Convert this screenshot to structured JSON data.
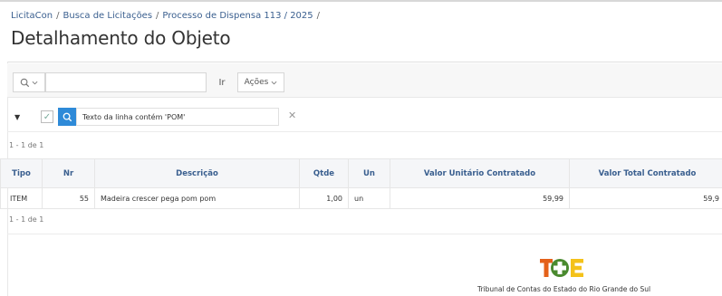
{
  "breadcrumb": {
    "items": [
      "LicitaCon",
      "Busca de Licitações",
      "Processo de Dispensa 113 / 2025"
    ],
    "separator": "/"
  },
  "page": {
    "title": "Detalhamento do Objeto"
  },
  "toolbar": {
    "search_placeholder": "",
    "go_label": "Ir",
    "actions_label": "Ações"
  },
  "filter": {
    "text": "Texto da linha contém 'POM'",
    "enabled": true
  },
  "pagination": {
    "top": "1 - 1 de 1",
    "bottom": "1 - 1 de 1"
  },
  "table": {
    "headers": [
      "Tipo",
      "Nr",
      "Descrição",
      "Qtde",
      "Un",
      "Valor Unitário Contratado",
      "Valor Total Contratado"
    ],
    "rows": [
      {
        "tipo": "ITEM",
        "nr": "55",
        "descricao": "Madeira crescer pega pom pom",
        "qtde": "1,00",
        "un": "un",
        "valor_unitario": "59,99",
        "valor_total": "59,9"
      }
    ]
  },
  "footer": {
    "logo_text": "TCE",
    "caption": "Tribunal de Contas do Estado do Rio Grande do Sul"
  },
  "colors": {
    "accent": "#2e8ad8",
    "link": "#3a5f8f",
    "logo_orange": "#e4611a",
    "logo_yellow": "#f4c21a",
    "logo_green": "#4a8a2f"
  }
}
